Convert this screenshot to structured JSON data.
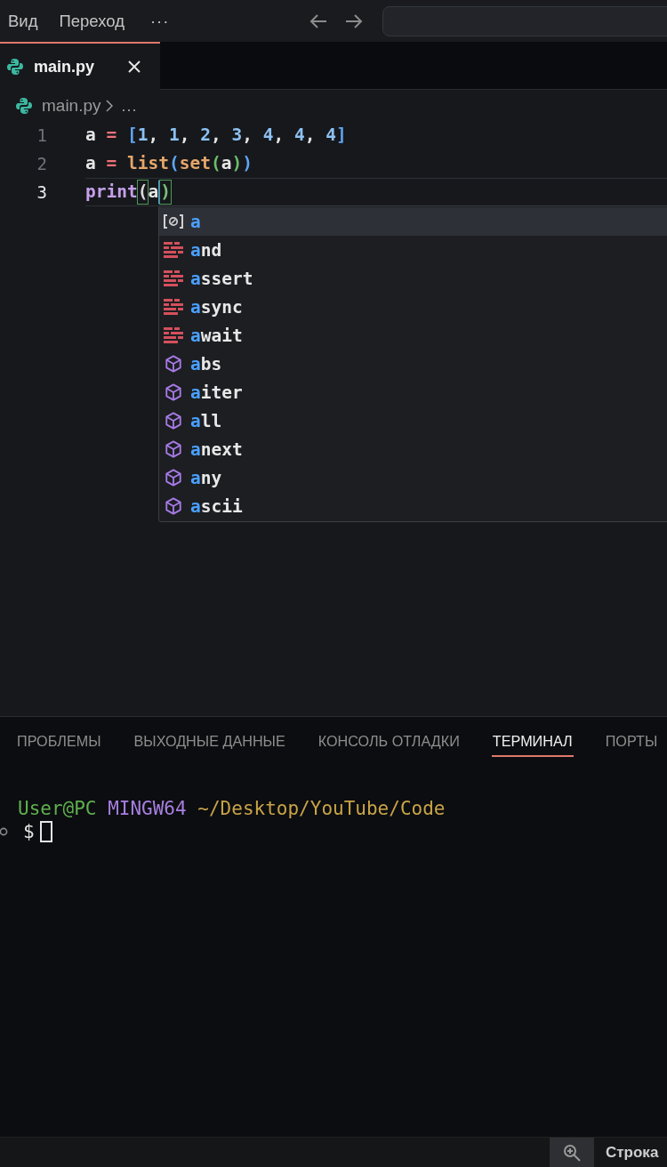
{
  "menu_bar": {
    "items": [
      {
        "label": "Вид"
      },
      {
        "label": "Переход"
      }
    ],
    "more": "···"
  },
  "editor_tabs": [
    {
      "label": "main.py",
      "selected": true
    }
  ],
  "breadcrumb": [
    "main.py",
    "…"
  ],
  "code": [
    {
      "number": "1",
      "current": false,
      "tokens": [
        {
          "text": "a ",
          "color": "#e6e6e6",
          "matched": false,
          "caret": false
        },
        {
          "text": "= ",
          "color": "#f0727a",
          "matched": false,
          "caret": false
        },
        {
          "text": "[",
          "color": "#5fa4f2",
          "matched": false,
          "caret": false
        },
        {
          "text": "1",
          "color": "#8dc1f2",
          "matched": false,
          "caret": false
        },
        {
          "text": ", ",
          "color": "#e6e6e6",
          "matched": false,
          "caret": false
        },
        {
          "text": "1",
          "color": "#8dc1f2",
          "matched": false,
          "caret": false
        },
        {
          "text": ", ",
          "color": "#e6e6e6",
          "matched": false,
          "caret": false
        },
        {
          "text": "2",
          "color": "#8dc1f2",
          "matched": false,
          "caret": false
        },
        {
          "text": ", ",
          "color": "#e6e6e6",
          "matched": false,
          "caret": false
        },
        {
          "text": "3",
          "color": "#8dc1f2",
          "matched": false,
          "caret": false
        },
        {
          "text": ", ",
          "color": "#e6e6e6",
          "matched": false,
          "caret": false
        },
        {
          "text": "4",
          "color": "#8dc1f2",
          "matched": false,
          "caret": false
        },
        {
          "text": ", ",
          "color": "#e6e6e6",
          "matched": false,
          "caret": false
        },
        {
          "text": "4",
          "color": "#8dc1f2",
          "matched": false,
          "caret": false
        },
        {
          "text": ", ",
          "color": "#e6e6e6",
          "matched": false,
          "caret": false
        },
        {
          "text": "4",
          "color": "#8dc1f2",
          "matched": false,
          "caret": false
        },
        {
          "text": "]",
          "color": "#5fa4f2",
          "matched": false,
          "caret": false
        }
      ]
    },
    {
      "number": "2",
      "current": false,
      "tokens": [
        {
          "text": "a ",
          "color": "#e6e6e6",
          "matched": false,
          "caret": false
        },
        {
          "text": "= ",
          "color": "#f0727a",
          "matched": false,
          "caret": false
        },
        {
          "text": "list",
          "color": "#e6a66a",
          "matched": false,
          "caret": false
        },
        {
          "text": "(",
          "color": "#5fa4f2",
          "matched": false,
          "caret": false
        },
        {
          "text": "set",
          "color": "#e6a66a",
          "matched": false,
          "caret": false
        },
        {
          "text": "(",
          "color": "#6cbd6c",
          "matched": false,
          "caret": false
        },
        {
          "text": "a",
          "color": "#e6e6e6",
          "matched": false,
          "caret": false
        },
        {
          "text": ")",
          "color": "#6cbd6c",
          "matched": false,
          "caret": false
        },
        {
          "text": ")",
          "color": "#5fa4f2",
          "matched": false,
          "caret": false
        }
      ]
    },
    {
      "number": "3",
      "current": true,
      "tokens": [
        {
          "text": "print",
          "color": "#c6a0ea",
          "matched": false,
          "caret": false
        },
        {
          "text": "(",
          "color": "#d9d9d9",
          "matched": true,
          "caret": false
        },
        {
          "text": "a",
          "color": "#e6e6e6",
          "matched": false,
          "caret": true
        },
        {
          "text": ")",
          "color": "#79c279",
          "matched": true,
          "caret": false
        }
      ]
    }
  ],
  "suggestions": [
    {
      "kind": "variable",
      "match": "a",
      "selected": true
    },
    {
      "kind": "keyword",
      "match": "a",
      "rest": "nd",
      "selected": false
    },
    {
      "kind": "keyword",
      "match": "a",
      "rest": "ssert",
      "selected": false
    },
    {
      "kind": "keyword",
      "match": "a",
      "rest": "sync",
      "selected": false
    },
    {
      "kind": "keyword",
      "match": "a",
      "rest": "wait",
      "selected": false
    },
    {
      "kind": "function",
      "match": "a",
      "rest": "bs",
      "selected": false
    },
    {
      "kind": "function",
      "match": "a",
      "rest": "iter",
      "selected": false
    },
    {
      "kind": "function",
      "match": "a",
      "rest": "ll",
      "selected": false
    },
    {
      "kind": "function",
      "match": "a",
      "rest": "next",
      "selected": false
    },
    {
      "kind": "function",
      "match": "a",
      "rest": "ny",
      "selected": false
    },
    {
      "kind": "function",
      "match": "a",
      "rest": "scii",
      "selected": false
    }
  ],
  "panel_tabs": [
    {
      "label": "ПРОБЛЕМЫ",
      "selected": false
    },
    {
      "label": "ВЫХОДНЫЕ ДАННЫЕ",
      "selected": false
    },
    {
      "label": "КОНСОЛЬ ОТЛАДКИ",
      "selected": false
    },
    {
      "label": "ТЕРМИНАЛ",
      "selected": true
    },
    {
      "label": "ПОРТЫ",
      "selected": false
    }
  ],
  "terminal": {
    "prompt": [
      {
        "text": "User@PC",
        "color": "#5fb04f"
      },
      {
        "text": "MINGW64",
        "color": "#a77fe0"
      },
      {
        "text": "~/Desktop/YouTube/Code",
        "color": "#c9a447"
      }
    ],
    "input_symbol": "$"
  },
  "status_bar": {
    "position": "Строка"
  }
}
